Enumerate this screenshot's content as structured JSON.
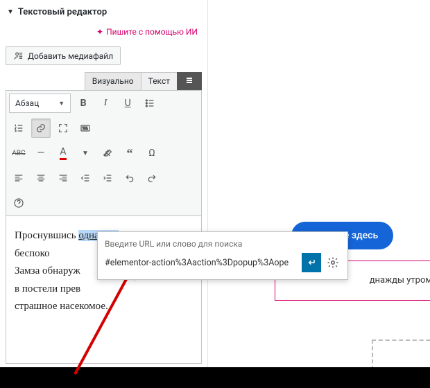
{
  "panel": {
    "title": "Текстовый редактор",
    "ai_link": "Пишите с помощью ИИ",
    "media_btn": "Добавить медиафайл",
    "tabs": {
      "visual": "Визуально",
      "text": "Текст"
    },
    "format_select": "Абзац"
  },
  "editor": {
    "before_link": "Проснувшись ",
    "link_word": "однажды",
    "after_link": " утром после беспоко",
    "line3": "Замза обнаруж",
    "line4": "в постели прев",
    "line5": "страшное насекомое."
  },
  "popover": {
    "label": "Введите URL или слово для поиска",
    "value": "#elementor-action%3Aaction%3Dpopup%3Aope"
  },
  "preview": {
    "button": "Нажмите здесь",
    "frame_text": "днажды утром"
  }
}
